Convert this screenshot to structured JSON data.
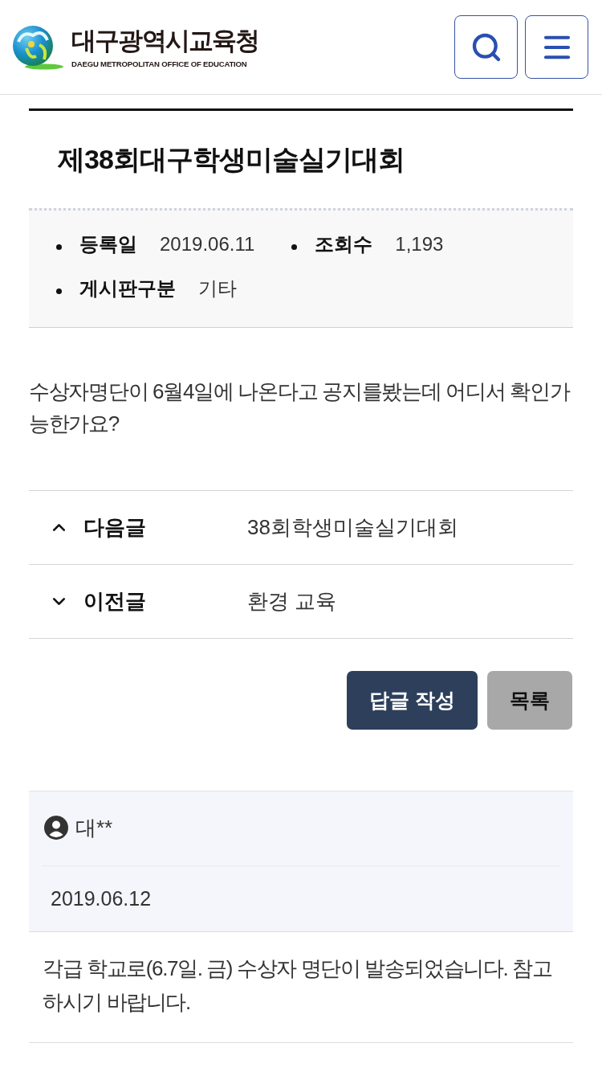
{
  "header": {
    "logo_title": "대구광역시교육청",
    "logo_subtitle": "DAEGU METROPOLITAN OFFICE OF EDUCATION"
  },
  "post": {
    "title": "제38회대구학생미술실기대회",
    "meta": [
      {
        "label": "등록일",
        "value": "2019.06.11"
      },
      {
        "label": "조회수",
        "value": "1,193"
      },
      {
        "label": "게시판구분",
        "value": "기타"
      }
    ],
    "body": "수상자명단이 6월4일에 나온다고 공지를봤는데 어디서 확인가능한가요?"
  },
  "navigation": [
    {
      "kind": "next",
      "label": "다음글",
      "title": "38회학생미술실기대회"
    },
    {
      "kind": "previous",
      "label": "이전글",
      "title": "환경 교육"
    }
  ],
  "buttons": [
    {
      "kind": "primary",
      "label": "답글 작성"
    },
    {
      "kind": "secondary",
      "label": "목록"
    }
  ],
  "reply": {
    "author": "대**",
    "date": "2019.06.12",
    "body": "각급 학교로(6.7일. 금) 수상자 명단이 발송되었습니다. 참고하시기 바랍니다."
  }
}
